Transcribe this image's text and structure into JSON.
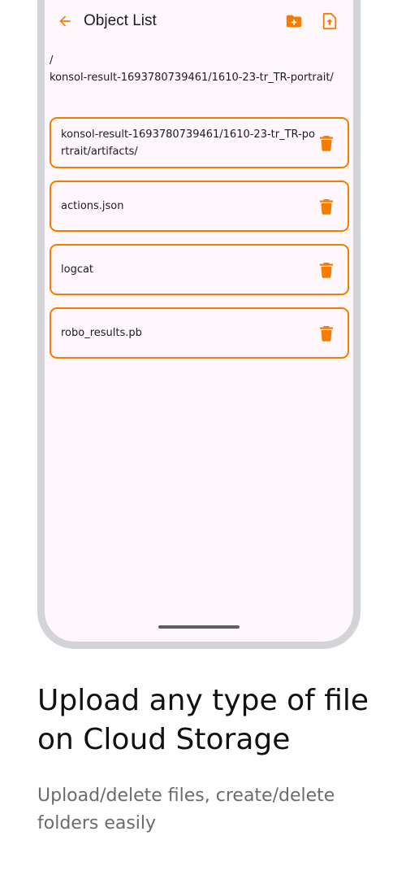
{
  "appbar": {
    "title": "Object List",
    "back_icon": "arrow-left-icon",
    "new_folder_icon": "folder-plus-icon",
    "upload_icon": "file-upload-icon"
  },
  "path": "/\nkonsol-result-1693780739461/1610-23-tr_TR-portrait/",
  "items": [
    {
      "label": "konsol-result-1693780739461/1610-23-tr_TR-portrait/artifacts/"
    },
    {
      "label": "actions.json"
    },
    {
      "label": "logcat"
    },
    {
      "label": "robo_results.pb"
    }
  ],
  "headline": "Upload any type of file on Cloud Storage",
  "subtext": "Upload/delete files, create/delete folders easily",
  "colors": {
    "accent": "#f57c00",
    "screen_bg": "#fef7fb",
    "frame": "#d3d3d8"
  }
}
